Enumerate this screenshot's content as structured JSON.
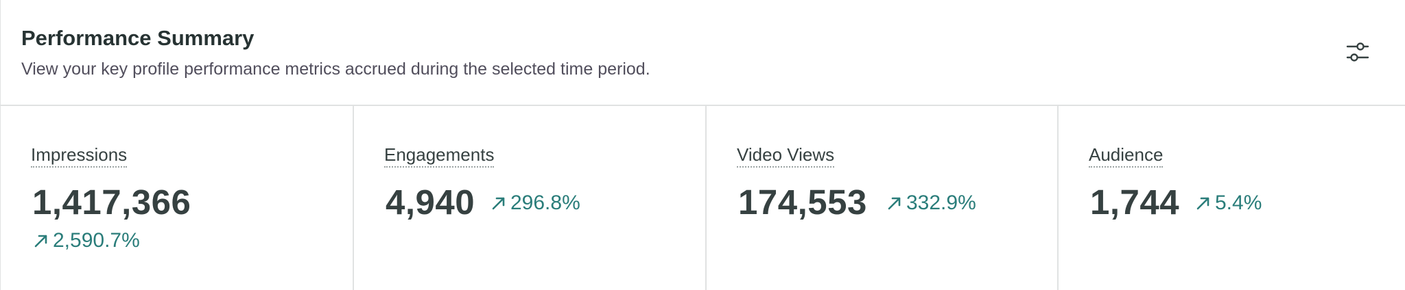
{
  "header": {
    "title": "Performance Summary",
    "subtitle": "View your key profile performance metrics accrued during the selected time period.",
    "settings_icon": "sliders-icon"
  },
  "metrics": [
    {
      "label": "Impressions",
      "value": "1,417,366",
      "change": "2,590.7%",
      "trend": "up"
    },
    {
      "label": "Engagements",
      "value": "4,940",
      "change": "296.8%",
      "trend": "up"
    },
    {
      "label": "Video Views",
      "value": "174,553",
      "change": "332.9%",
      "trend": "up"
    },
    {
      "label": "Audience",
      "value": "1,744",
      "change": "5.4%",
      "trend": "up"
    }
  ],
  "colors": {
    "positive_change": "#2a7d7a",
    "text": "#364141",
    "divider": "#e0e2e2"
  }
}
